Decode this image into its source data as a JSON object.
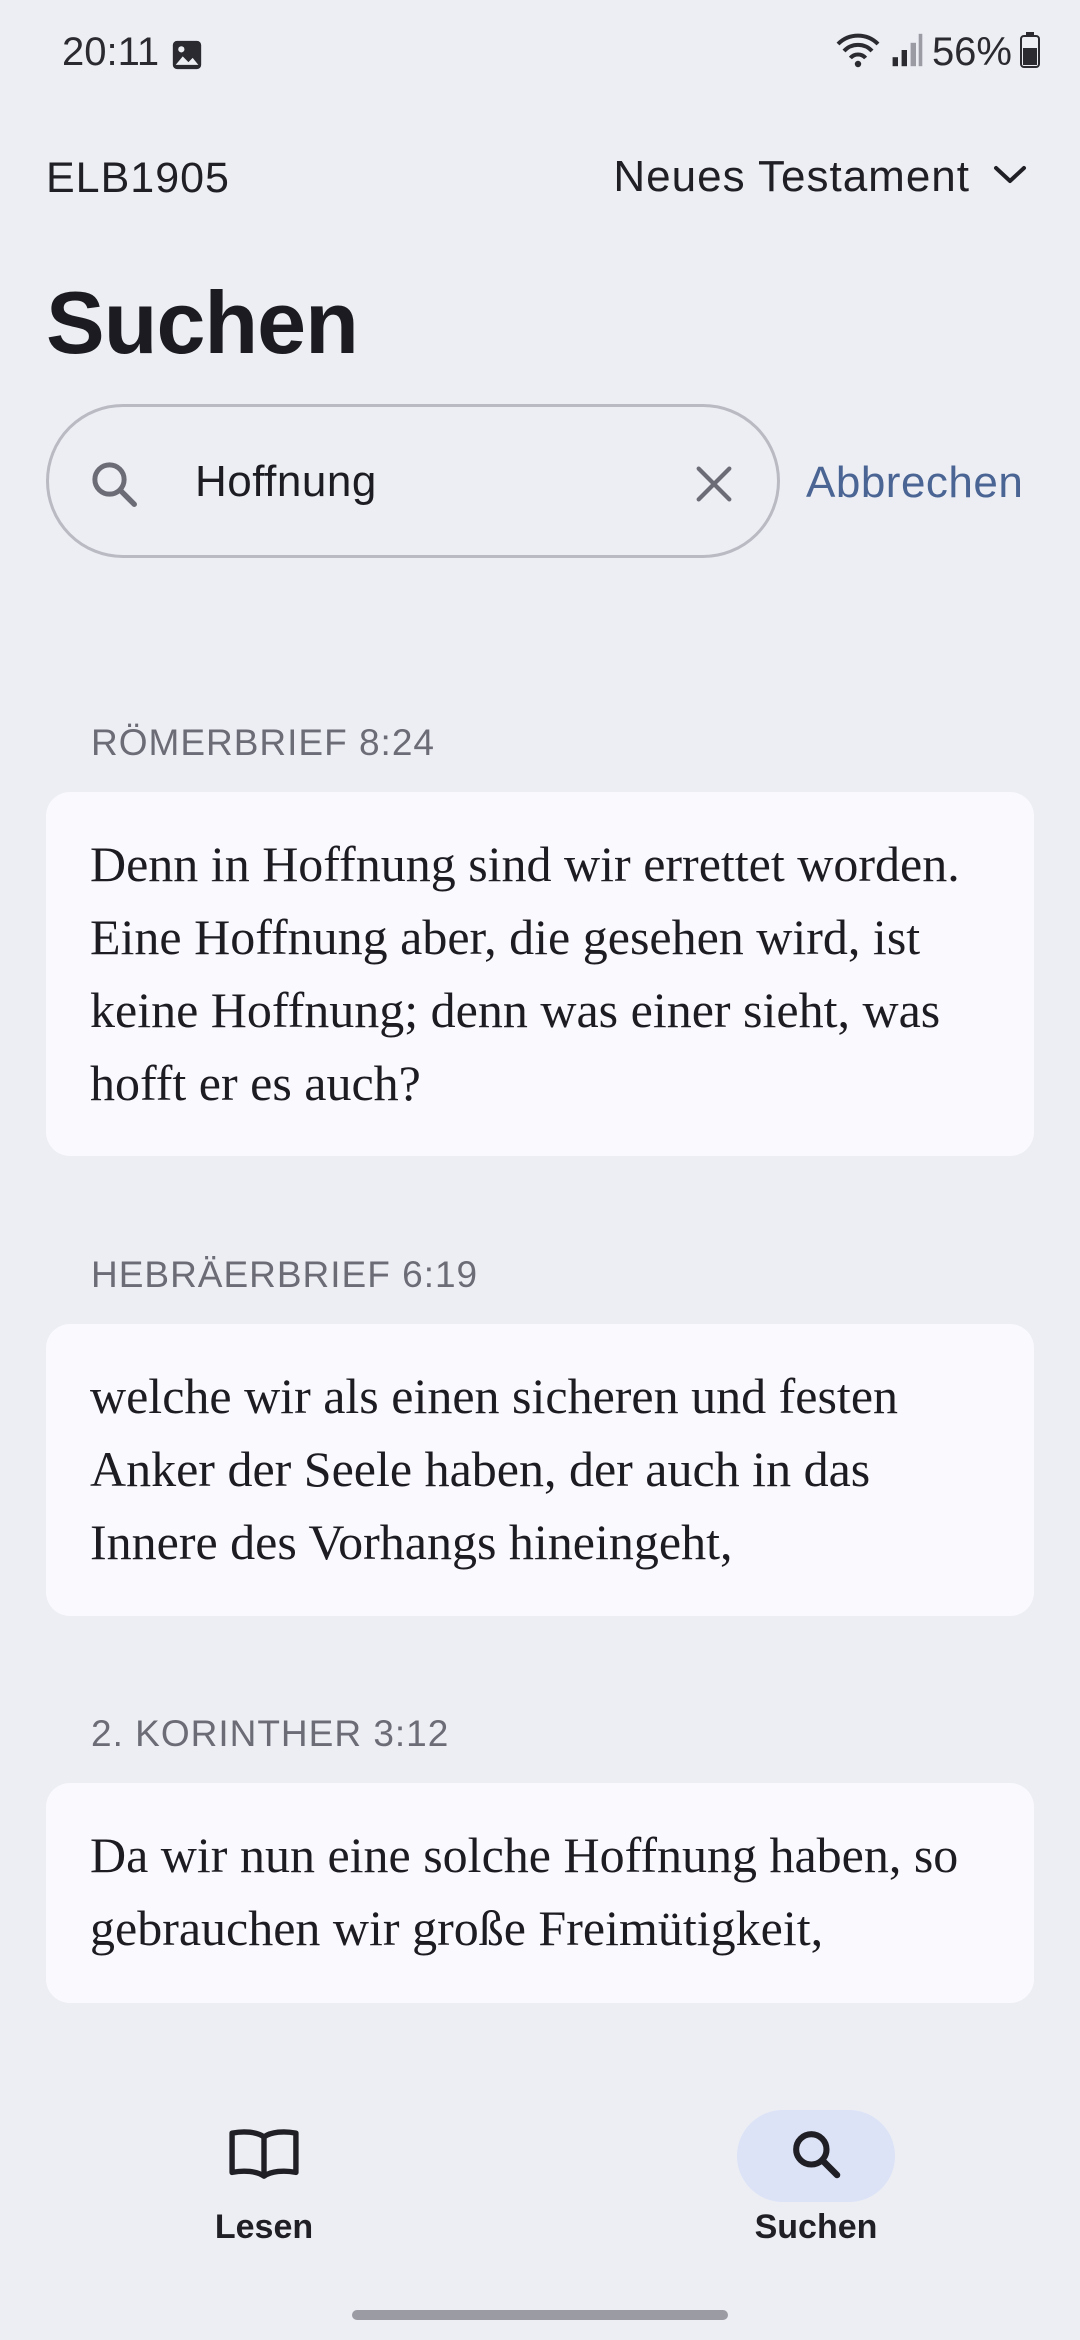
{
  "status": {
    "time": "20:11",
    "battery": "56%"
  },
  "header": {
    "version": "ELB1905",
    "testament": "Neues Testament",
    "title": "Suchen"
  },
  "search": {
    "query": "Hoffnung",
    "cancel_label": "Abbrechen"
  },
  "results": [
    {
      "reference": "RÖMERBRIEF 8:24",
      "text": "Denn in Hoffnung sind wir errettet worden. Eine Hoffnung aber, die gesehen wird, ist keine Hoffnung; denn was einer sieht, was hofft er es auch?"
    },
    {
      "reference": "HEBRÄERBRIEF 6:19",
      "text": "welche wir als einen sicheren und festen Anker der Seele haben, der auch in das Innere des Vorhangs hineingeht,"
    },
    {
      "reference": "2. KORINTHER 3:12",
      "text": "Da wir nun eine solche Hoffnung haben, so gebrauchen wir große Freimütigkeit,"
    }
  ],
  "nav": {
    "read_label": "Lesen",
    "search_label": "Suchen"
  },
  "colors": {
    "background": "#eceef4",
    "card": "#fafafe",
    "accent_link": "#4a6493",
    "active_pill": "#dce3f6"
  },
  "icons": {
    "gallery": "image-icon",
    "wifi": "wifi-icon",
    "signal": "signal-icon",
    "battery": "battery-icon",
    "dropdown": "chevron-down-icon",
    "search": "search-icon",
    "clear": "close-icon",
    "read": "book-icon"
  }
}
